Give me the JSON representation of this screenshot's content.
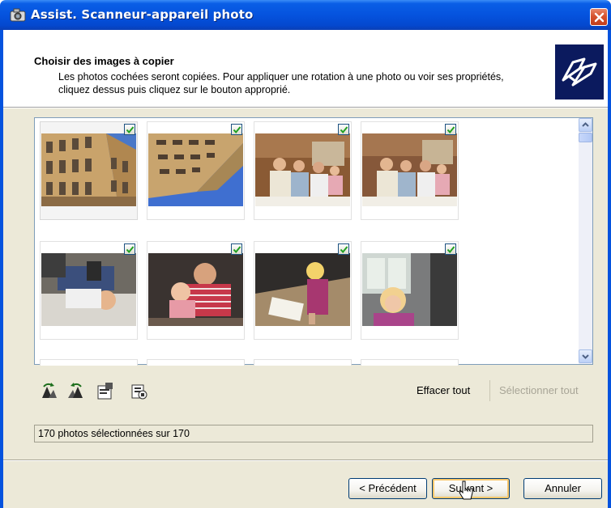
{
  "window": {
    "title": "Assist. Scanneur-appareil photo"
  },
  "header": {
    "title": "Choisir des images à copier",
    "description": "Les photos cochées seront copiées. Pour appliquer une rotation à une photo ou voir ses propriétés, cliquez dessus puis cliquez sur le bouton approprié."
  },
  "thumbnails": [
    {
      "checked": true,
      "subject": "building-facade"
    },
    {
      "checked": true,
      "subject": "building-upward"
    },
    {
      "checked": true,
      "subject": "family-at-table"
    },
    {
      "checked": true,
      "subject": "family-at-table-2"
    },
    {
      "checked": true,
      "subject": "child-playing"
    },
    {
      "checked": true,
      "subject": "child-on-lap"
    },
    {
      "checked": true,
      "subject": "child-reading"
    },
    {
      "checked": true,
      "subject": "child-portrait"
    }
  ],
  "toolbar": {
    "icons": [
      "rotate-right-icon",
      "rotate-left-icon",
      "properties-icon",
      "details-icon"
    ],
    "clear_all": "Effacer tout",
    "select_all": "Sélectionner tout"
  },
  "status": {
    "text": "170 photos sélectionnées sur 170"
  },
  "buttons": {
    "back": "< Précédent",
    "next": "Suivant >",
    "cancel": "Annuler"
  },
  "colors": {
    "titlebar": "#0553de",
    "close": "#d6532f",
    "dialog_bg": "#ece9d8",
    "logo_bg": "#0b1a5e"
  }
}
